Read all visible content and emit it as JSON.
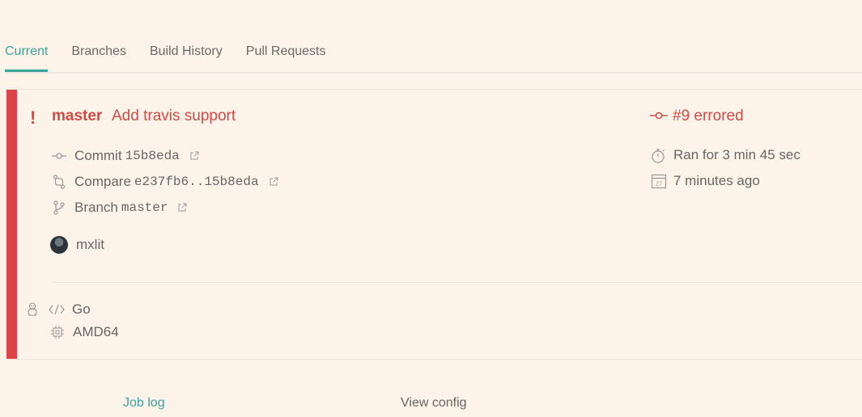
{
  "tabs": [
    {
      "label": "Current",
      "active": true
    },
    {
      "label": "Branches",
      "active": false
    },
    {
      "label": "Build History",
      "active": false
    },
    {
      "label": "Pull Requests",
      "active": false
    }
  ],
  "build": {
    "state_mark": "!",
    "branch": "master",
    "message": "Add travis support",
    "status": "#9 errored",
    "commit_label": "Commit",
    "commit_sha": "15b8eda",
    "compare_label": "Compare",
    "compare_range": "e237fb6..15b8eda",
    "branch_label": "Branch",
    "branch_value": "master",
    "author": "mxlit",
    "duration": "Ran for 3 min 45 sec",
    "finished": "7 minutes ago",
    "language": "Go",
    "arch": "AMD64",
    "calendar_day": "27"
  },
  "bottom": {
    "job_log": "Job log",
    "view_config": "View config"
  },
  "colors": {
    "background": "#fdf3e9",
    "accent": "#3aa39a",
    "error": "#dd4448"
  }
}
